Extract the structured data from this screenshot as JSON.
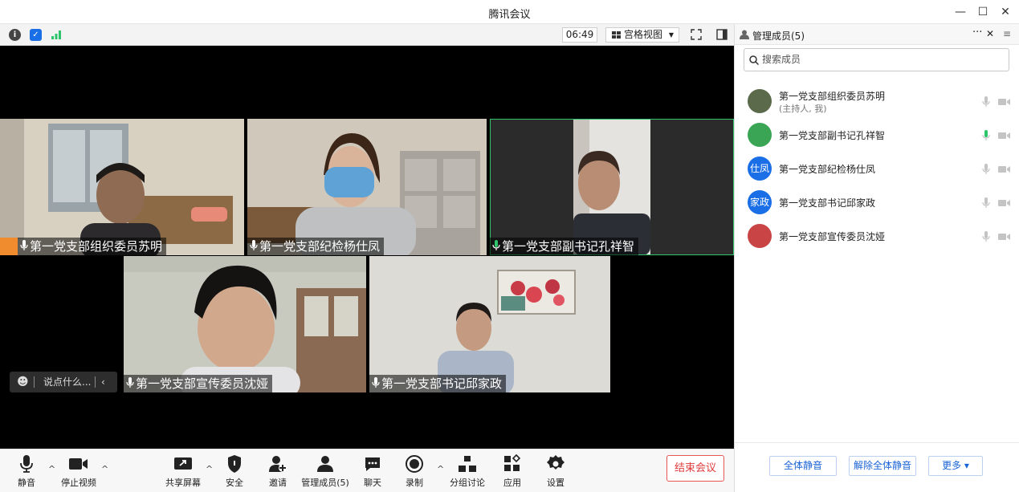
{
  "window": {
    "title": "腾讯会议",
    "minimize": "—",
    "maximize": "☐",
    "close": "✕"
  },
  "topstrip": {
    "timer": "06:49",
    "view_label": "宫格视图"
  },
  "tiles": [
    {
      "name": "第一党支部组织委员苏明",
      "host": true,
      "active": false
    },
    {
      "name": "第一党支部纪检杨仕凤",
      "host": false,
      "active": false
    },
    {
      "name": "第一党支部副书记孔祥智",
      "host": false,
      "active": true
    },
    {
      "name": "第一党支部宣传委员沈娅",
      "host": false,
      "active": false
    },
    {
      "name": "第一党支部书记邱家政",
      "host": false,
      "active": false
    }
  ],
  "chat": {
    "placeholder": "说点什么..."
  },
  "toolbar": {
    "mute": "静音",
    "stop_video": "停止视频",
    "share_screen": "共享屏幕",
    "security": "安全",
    "invite": "邀请",
    "manage_members": "管理成员(5)",
    "chat": "聊天",
    "record": "录制",
    "breakout": "分组讨论",
    "apps": "应用",
    "settings": "设置",
    "end_meeting": "结束会议"
  },
  "panel": {
    "title": "管理成员(5)",
    "more": "···",
    "close": "✕",
    "search_placeholder": "搜索成员",
    "members": [
      {
        "name": "第一党支部组织委员苏明",
        "sub": "(主持人, 我)",
        "avatar_text": "",
        "avatar_color": "#5a6a4a",
        "mic_active": false
      },
      {
        "name": "第一党支部副书记孔祥智",
        "sub": "",
        "avatar_text": "",
        "avatar_color": "#3aa655",
        "mic_active": true
      },
      {
        "name": "第一党支部纪检杨仕凤",
        "sub": "",
        "avatar_text": "仕凤",
        "avatar_color": "#1a6ee6",
        "mic_active": false
      },
      {
        "name": "第一党支部书记邱家政",
        "sub": "",
        "avatar_text": "家政",
        "avatar_color": "#1a6ee6",
        "mic_active": false
      },
      {
        "name": "第一党支部宣传委员沈娅",
        "sub": "",
        "avatar_text": "",
        "avatar_color": "#c94444",
        "mic_active": false
      }
    ],
    "mute_all": "全体静音",
    "unmute_all": "解除全体静音",
    "more_btn": "更多 ▾"
  },
  "colors": {
    "accent": "#1a63d6",
    "active_speaker": "#2ec46b",
    "end_red": "#e03b3b"
  }
}
